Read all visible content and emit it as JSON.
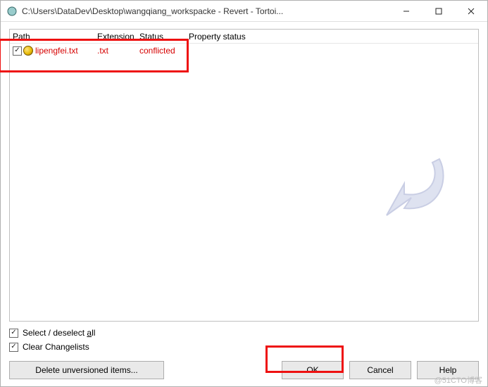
{
  "titlebar": {
    "title": "C:\\Users\\DataDev\\Desktop\\wangqiang_workspacke - Revert - Tortoi..."
  },
  "list": {
    "headers": {
      "path": "Path",
      "extension": "Extension",
      "status": "Status",
      "property_status": "Property status"
    },
    "rows": [
      {
        "checked": true,
        "path": "lipengfei.txt",
        "extension": ".txt",
        "status": "conflicted",
        "property_status": "",
        "is_conflict": true
      }
    ]
  },
  "options": {
    "select_all_prefix": "Select / deselect ",
    "select_all_ul": "a",
    "select_all_suffix": "ll",
    "clear_changelists": "Clear Changelists"
  },
  "buttons": {
    "delete_unversioned": "Delete unversioned items...",
    "ok": "OK",
    "cancel": "Cancel",
    "help": "Help"
  },
  "watermark": "@51CTO博客"
}
